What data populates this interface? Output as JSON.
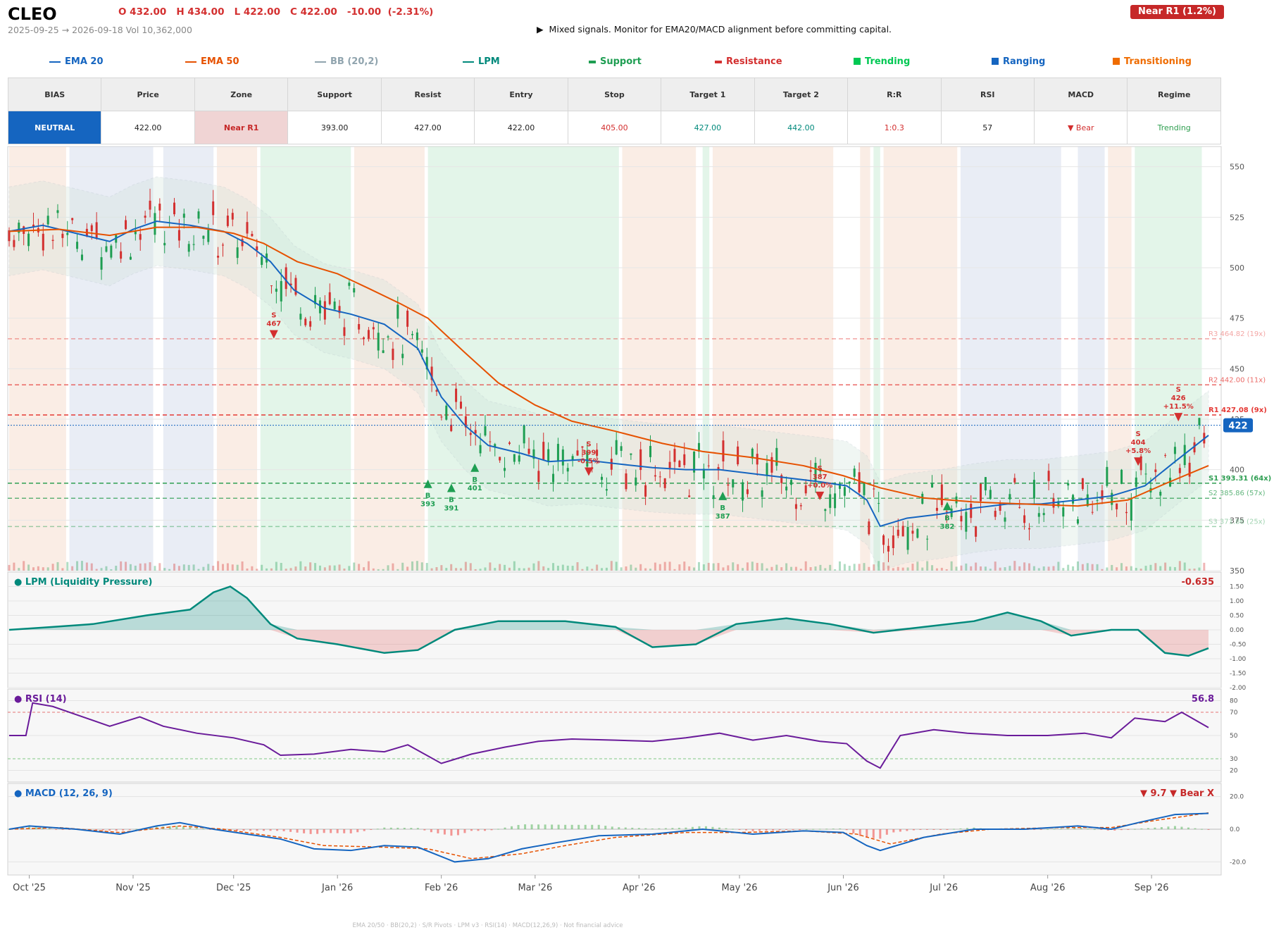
{
  "header": {
    "ticker": "CLEO",
    "ohlc_text": "O 432.00   H 434.00   L 422.00   C 422.00   -10.00  (-2.31%)",
    "range_text": "2025-09-25 → 2026-09-18   Vol 10,362,000",
    "message": "▶  Mixed signals. Monitor for EMA20/MACD alignment before committing capital.",
    "zone_badge": "Near R1  (1.2%)"
  },
  "legend": [
    {
      "label": "EMA 20",
      "color": "#1565c0",
      "swatch": "line"
    },
    {
      "label": "EMA 50",
      "color": "#e65100",
      "swatch": "line"
    },
    {
      "label": "BB (20,2)",
      "color": "#90a4ae",
      "swatch": "line"
    },
    {
      "label": "LPM",
      "color": "#00897b",
      "swatch": "line"
    },
    {
      "label": "Support",
      "color": "#1e9e52",
      "swatch": "dash"
    },
    {
      "label": "Resistance",
      "color": "#d32f2f",
      "swatch": "dash"
    },
    {
      "label": "Trending",
      "color": "#00c853",
      "swatch": "box"
    },
    {
      "label": "Ranging",
      "color": "#1565c0",
      "swatch": "box"
    },
    {
      "label": "Transitioning",
      "color": "#ef6c00",
      "swatch": "box"
    }
  ],
  "metrics": {
    "headers": [
      "BIAS",
      "Price",
      "Zone",
      "Support",
      "Resist",
      "Entry",
      "Stop",
      "Target 1",
      "Target 2",
      "R:R",
      "RSI",
      "MACD",
      "Regime"
    ],
    "values": [
      "NEUTRAL",
      "422.00",
      "Near R1",
      "393.00",
      "427.00",
      "422.00",
      "405.00",
      "427.00",
      "442.00",
      "1:0.3",
      "57",
      "▼ Bear",
      "Trending"
    ],
    "colors": [
      "#ffffff",
      "#222222",
      "#c62828",
      "#222222",
      "#222222",
      "#222222",
      "#d32f2f",
      "#00897b",
      "#00897b",
      "#d32f2f",
      "#222222",
      "#d32f2f",
      "#2e9e4f"
    ],
    "backgrounds": [
      "#1565c0",
      "#ffffff",
      "#f0d4d4",
      "#ffffff",
      "#ffffff",
      "#ffffff",
      "#ffffff",
      "#ffffff",
      "#ffffff",
      "#ffffff",
      "#ffffff",
      "#ffffff",
      "#ffffff"
    ]
  },
  "chart_data": {
    "type": "line",
    "price_axis": {
      "ticks": [
        "550",
        "525",
        "500",
        "475",
        "450",
        "425",
        "400",
        "375",
        "350"
      ],
      "ylim": [
        350,
        560
      ]
    },
    "date_labels": [
      "Oct '25",
      "Nov '25",
      "Dec '25",
      "Jan '26",
      "Feb '26",
      "Mar '26",
      "Apr '26",
      "May '26",
      "Jun '26",
      "Jul '26",
      "Aug '26",
      "Sep '26"
    ],
    "xlim": [
      "2025-09-25",
      "2026-09-18"
    ],
    "regimes": [
      {
        "from": "2025-09-25",
        "to": "2025-10-12",
        "type": "Transitioning"
      },
      {
        "from": "2025-10-13",
        "to": "2025-11-07",
        "type": "Ranging"
      },
      {
        "from": "2025-11-10",
        "to": "2025-11-25",
        "type": "Ranging"
      },
      {
        "from": "2025-11-26",
        "to": "2025-12-08",
        "type": "Transitioning"
      },
      {
        "from": "2025-12-09",
        "to": "2026-01-05",
        "type": "Trending"
      },
      {
        "from": "2026-01-06",
        "to": "2026-01-27",
        "type": "Transitioning"
      },
      {
        "from": "2026-01-28",
        "to": "2026-03-26",
        "type": "Trending"
      },
      {
        "from": "2026-03-27",
        "to": "2026-04-18",
        "type": "Transitioning"
      },
      {
        "from": "2026-04-20",
        "to": "2026-04-22",
        "type": "Trending"
      },
      {
        "from": "2026-04-23",
        "to": "2026-05-29",
        "type": "Transitioning"
      },
      {
        "from": "2026-06-06",
        "to": "2026-06-09",
        "type": "Transitioning"
      },
      {
        "from": "2026-06-10",
        "to": "2026-06-12",
        "type": "Trending"
      },
      {
        "from": "2026-06-13",
        "to": "2026-07-05",
        "type": "Transitioning"
      },
      {
        "from": "2026-07-06",
        "to": "2026-08-05",
        "type": "Ranging"
      },
      {
        "from": "2026-08-10",
        "to": "2026-08-18",
        "type": "Ranging"
      },
      {
        "from": "2026-08-19",
        "to": "2026-08-26",
        "type": "Transitioning"
      },
      {
        "from": "2026-08-27",
        "to": "2026-09-16",
        "type": "Trending"
      }
    ],
    "levels": [
      {
        "label": "R3 464.82 (19x)",
        "value": 464.82,
        "kind": "resistance"
      },
      {
        "label": "R2 442.00 (11x)",
        "value": 442.0,
        "kind": "resistance"
      },
      {
        "label": "R1 427.08 (9x)",
        "value": 427.08,
        "kind": "resistance"
      },
      {
        "label": "S1 393.31 (64x)",
        "value": 393.31,
        "kind": "support"
      },
      {
        "label": "S2 385.86 (57x)",
        "value": 385.86,
        "kind": "support"
      },
      {
        "label": "S3 371.86 (25x)",
        "value": 371.86,
        "kind": "support"
      }
    ],
    "last_price": {
      "label": "422",
      "value": 422
    },
    "signals": [
      {
        "date": "2025-12-13",
        "price": 467,
        "side": "S",
        "text": "S\n467"
      },
      {
        "date": "2026-01-28",
        "price": 393,
        "side": "B",
        "text": "B\n393"
      },
      {
        "date": "2026-02-04",
        "price": 391,
        "side": "B",
        "text": "B\n391"
      },
      {
        "date": "2026-02-11",
        "price": 401,
        "side": "B",
        "text": "B\n401"
      },
      {
        "date": "2026-03-17",
        "price": 399,
        "side": "S",
        "text": "S\n399\n-0.5%"
      },
      {
        "date": "2026-04-26",
        "price": 387,
        "side": "B",
        "text": "B\n387"
      },
      {
        "date": "2026-05-25",
        "price": 387,
        "side": "S",
        "text": "S\n387\n+0.0%"
      },
      {
        "date": "2026-07-02",
        "price": 382,
        "side": "B",
        "text": "B\n382"
      },
      {
        "date": "2026-08-28",
        "price": 404,
        "side": "S",
        "text": "S\n404\n+5.8%"
      },
      {
        "date": "2026-09-09",
        "price": 426,
        "side": "S",
        "text": "S\n426\n+11.5%"
      }
    ],
    "series": [
      {
        "name": "EMA 20",
        "points": [
          [
            "2025-09-25",
            518
          ],
          [
            "2025-10-05",
            521
          ],
          [
            "2025-10-15",
            517
          ],
          [
            "2025-10-25",
            513
          ],
          [
            "2025-11-01",
            519
          ],
          [
            "2025-11-08",
            523
          ],
          [
            "2025-11-18",
            521
          ],
          [
            "2025-11-28",
            518
          ],
          [
            "2025-12-05",
            512
          ],
          [
            "2025-12-12",
            503
          ],
          [
            "2025-12-19",
            489
          ],
          [
            "2025-12-28",
            480
          ],
          [
            "2026-01-05",
            477
          ],
          [
            "2026-01-15",
            472
          ],
          [
            "2026-01-25",
            460
          ],
          [
            "2026-02-01",
            436
          ],
          [
            "2026-02-08",
            422
          ],
          [
            "2026-02-15",
            412
          ],
          [
            "2026-02-25",
            408
          ],
          [
            "2026-03-05",
            404
          ],
          [
            "2026-03-15",
            405
          ],
          [
            "2026-03-25",
            403
          ],
          [
            "2026-04-05",
            401
          ],
          [
            "2026-04-15",
            400
          ],
          [
            "2026-04-25",
            400
          ],
          [
            "2026-05-05",
            398
          ],
          [
            "2026-05-15",
            396
          ],
          [
            "2026-05-25",
            394
          ],
          [
            "2026-06-02",
            392
          ],
          [
            "2026-06-08",
            385
          ],
          [
            "2026-06-12",
            372
          ],
          [
            "2026-06-20",
            376
          ],
          [
            "2026-06-30",
            378
          ],
          [
            "2026-07-10",
            381
          ],
          [
            "2026-07-20",
            383
          ],
          [
            "2026-07-30",
            383
          ],
          [
            "2026-08-10",
            385
          ],
          [
            "2026-08-20",
            387
          ],
          [
            "2026-08-30",
            392
          ],
          [
            "2026-09-08",
            404
          ],
          [
            "2026-09-18",
            417
          ]
        ]
      },
      {
        "name": "EMA 50",
        "points": [
          [
            "2025-09-25",
            518
          ],
          [
            "2025-10-10",
            519
          ],
          [
            "2025-10-25",
            516
          ],
          [
            "2025-11-08",
            520
          ],
          [
            "2025-11-20",
            520
          ],
          [
            "2025-12-01",
            517
          ],
          [
            "2025-12-10",
            512
          ],
          [
            "2025-12-20",
            503
          ],
          [
            "2026-01-01",
            497
          ],
          [
            "2026-01-10",
            490
          ],
          [
            "2026-01-20",
            482
          ],
          [
            "2026-01-28",
            475
          ],
          [
            "2026-02-08",
            458
          ],
          [
            "2026-02-18",
            443
          ],
          [
            "2026-03-01",
            432
          ],
          [
            "2026-03-12",
            424
          ],
          [
            "2026-03-25",
            419
          ],
          [
            "2026-04-08",
            413
          ],
          [
            "2026-04-20",
            409
          ],
          [
            "2026-05-05",
            406
          ],
          [
            "2026-05-20",
            402
          ],
          [
            "2026-06-01",
            397
          ],
          [
            "2026-06-12",
            391
          ],
          [
            "2026-06-25",
            386
          ],
          [
            "2026-07-10",
            384
          ],
          [
            "2026-07-25",
            383
          ],
          [
            "2026-08-10",
            382
          ],
          [
            "2026-08-25",
            385
          ],
          [
            "2026-09-05",
            393
          ],
          [
            "2026-09-18",
            402
          ]
        ]
      }
    ],
    "lpm": {
      "value_label": "-0.635",
      "ticks": [
        "1.50",
        "1.00",
        "0.50",
        "0.00",
        "-0.50",
        "-1.00",
        "-1.50",
        "-2.00"
      ],
      "ylim": [
        -2,
        2
      ],
      "points": [
        [
          "2025-09-25",
          0.0
        ],
        [
          "2025-10-08",
          0.1
        ],
        [
          "2025-10-20",
          0.2
        ],
        [
          "2025-11-05",
          0.5
        ],
        [
          "2025-11-18",
          0.7
        ],
        [
          "2025-11-25",
          1.3
        ],
        [
          "2025-11-30",
          1.5
        ],
        [
          "2025-12-05",
          1.1
        ],
        [
          "2025-12-12",
          0.2
        ],
        [
          "2025-12-20",
          -0.3
        ],
        [
          "2026-01-01",
          -0.5
        ],
        [
          "2026-01-15",
          -0.8
        ],
        [
          "2026-01-25",
          -0.7
        ],
        [
          "2026-02-05",
          0.0
        ],
        [
          "2026-02-18",
          0.3
        ],
        [
          "2026-03-10",
          0.3
        ],
        [
          "2026-03-25",
          0.1
        ],
        [
          "2026-04-05",
          -0.6
        ],
        [
          "2026-04-18",
          -0.5
        ],
        [
          "2026-04-30",
          0.2
        ],
        [
          "2026-05-15",
          0.4
        ],
        [
          "2026-05-28",
          0.2
        ],
        [
          "2026-06-10",
          -0.1
        ],
        [
          "2026-06-25",
          0.1
        ],
        [
          "2026-07-10",
          0.3
        ],
        [
          "2026-07-20",
          0.6
        ],
        [
          "2026-07-30",
          0.3
        ],
        [
          "2026-08-08",
          -0.2
        ],
        [
          "2026-08-20",
          0.0
        ],
        [
          "2026-08-28",
          0.0
        ],
        [
          "2026-09-05",
          -0.8
        ],
        [
          "2026-09-12",
          -0.9
        ],
        [
          "2026-09-18",
          -0.635
        ]
      ]
    },
    "rsi": {
      "value_label": "56.8",
      "ticks": [
        "80",
        "70",
        "50",
        "30",
        "20"
      ],
      "ylim": [
        10,
        90
      ],
      "points": [
        [
          "2025-09-25",
          50
        ],
        [
          "2025-09-30",
          50
        ],
        [
          "2025-10-02",
          78
        ],
        [
          "2025-10-08",
          75
        ],
        [
          "2025-10-15",
          68
        ],
        [
          "2025-10-25",
          58
        ],
        [
          "2025-11-03",
          66
        ],
        [
          "2025-11-10",
          58
        ],
        [
          "2025-11-20",
          52
        ],
        [
          "2025-12-01",
          48
        ],
        [
          "2025-12-10",
          42
        ],
        [
          "2025-12-15",
          33
        ],
        [
          "2025-12-25",
          34
        ],
        [
          "2026-01-05",
          38
        ],
        [
          "2026-01-15",
          36
        ],
        [
          "2026-01-22",
          42
        ],
        [
          "2026-02-01",
          26
        ],
        [
          "2026-02-10",
          34
        ],
        [
          "2026-02-20",
          40
        ],
        [
          "2026-03-02",
          45
        ],
        [
          "2026-03-12",
          47
        ],
        [
          "2026-03-25",
          46
        ],
        [
          "2026-04-05",
          45
        ],
        [
          "2026-04-15",
          48
        ],
        [
          "2026-04-25",
          52
        ],
        [
          "2026-05-05",
          46
        ],
        [
          "2026-05-15",
          50
        ],
        [
          "2026-05-25",
          45
        ],
        [
          "2026-06-02",
          43
        ],
        [
          "2026-06-08",
          28
        ],
        [
          "2026-06-12",
          22
        ],
        [
          "2026-06-18",
          50
        ],
        [
          "2026-06-28",
          55
        ],
        [
          "2026-07-08",
          52
        ],
        [
          "2026-07-20",
          50
        ],
        [
          "2026-08-01",
          50
        ],
        [
          "2026-08-12",
          52
        ],
        [
          "2026-08-20",
          48
        ],
        [
          "2026-08-27",
          65
        ],
        [
          "2026-09-05",
          62
        ],
        [
          "2026-09-10",
          70
        ],
        [
          "2026-09-18",
          56.8
        ]
      ]
    },
    "macd": {
      "value_label": "▼ 9.7 ▼ Bear X",
      "ticks": [
        "20.0",
        "0.0",
        "-20.0"
      ],
      "ylim": [
        -28,
        28
      ],
      "macd_points": [
        [
          "2025-09-25",
          0
        ],
        [
          "2025-10-01",
          2
        ],
        [
          "2025-10-15",
          0
        ],
        [
          "2025-10-28",
          -3
        ],
        [
          "2025-11-08",
          2
        ],
        [
          "2025-11-15",
          4
        ],
        [
          "2025-11-25",
          0
        ],
        [
          "2025-12-05",
          -3
        ],
        [
          "2025-12-15",
          -6
        ],
        [
          "2025-12-25",
          -12
        ],
        [
          "2026-01-05",
          -13
        ],
        [
          "2026-01-15",
          -10
        ],
        [
          "2026-01-25",
          -11
        ],
        [
          "2026-02-05",
          -20
        ],
        [
          "2026-02-15",
          -18
        ],
        [
          "2026-02-25",
          -12
        ],
        [
          "2026-03-08",
          -8
        ],
        [
          "2026-03-20",
          -4
        ],
        [
          "2026-04-05",
          -3
        ],
        [
          "2026-04-20",
          0
        ],
        [
          "2026-05-05",
          -3
        ],
        [
          "2026-05-20",
          -1
        ],
        [
          "2026-06-01",
          -2
        ],
        [
          "2026-06-08",
          -10
        ],
        [
          "2026-06-12",
          -13
        ],
        [
          "2026-06-25",
          -5
        ],
        [
          "2026-07-10",
          0
        ],
        [
          "2026-07-25",
          0
        ],
        [
          "2026-08-10",
          2
        ],
        [
          "2026-08-20",
          0
        ],
        [
          "2026-08-28",
          4
        ],
        [
          "2026-09-08",
          9
        ],
        [
          "2026-09-18",
          9.7
        ]
      ],
      "signal_points": [
        [
          "2025-09-25",
          0
        ],
        [
          "2025-10-10",
          1
        ],
        [
          "2025-10-28",
          -2
        ],
        [
          "2025-11-15",
          2
        ],
        [
          "2025-11-28",
          0
        ],
        [
          "2025-12-15",
          -5
        ],
        [
          "2025-12-28",
          -10
        ],
        [
          "2026-01-15",
          -11
        ],
        [
          "2026-01-28",
          -12
        ],
        [
          "2026-02-10",
          -18
        ],
        [
          "2026-02-25",
          -15
        ],
        [
          "2026-03-10",
          -10
        ],
        [
          "2026-03-25",
          -5
        ],
        [
          "2026-04-15",
          -2
        ],
        [
          "2026-05-01",
          -2
        ],
        [
          "2026-05-20",
          -1
        ],
        [
          "2026-06-05",
          -3
        ],
        [
          "2026-06-15",
          -9
        ],
        [
          "2026-06-30",
          -3
        ],
        [
          "2026-07-15",
          0
        ],
        [
          "2026-08-05",
          1
        ],
        [
          "2026-08-20",
          1
        ],
        [
          "2026-09-01",
          5
        ],
        [
          "2026-09-18",
          10
        ]
      ]
    }
  },
  "footer": "EMA 20/50  ·  BB(20,2)  ·  S/R Pivots  ·  LPM v3  ·  RSI(14)  ·  MACD(12,26,9)  ·  Not financial advice"
}
